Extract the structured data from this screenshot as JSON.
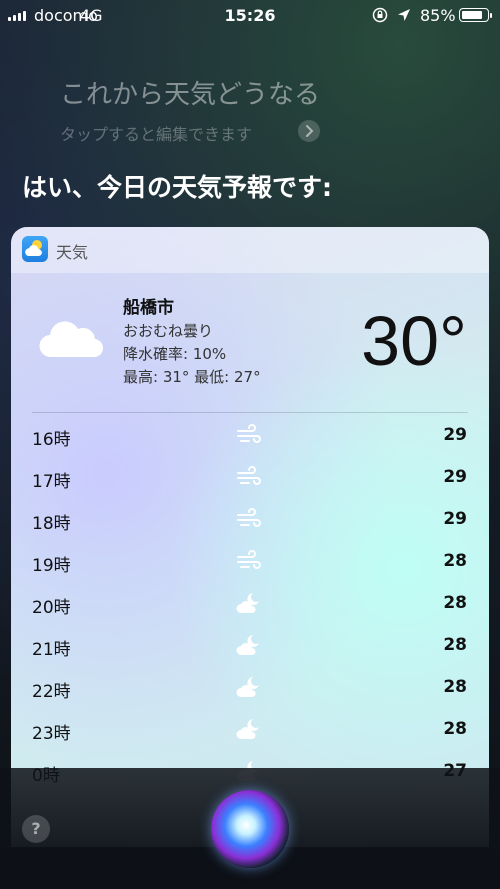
{
  "status": {
    "carrier": "docomo",
    "network": "4G",
    "time": "15:26",
    "battery": "85%",
    "battery_level": 0.85
  },
  "siri": {
    "query": "これから天気どうなる",
    "edit_hint": "タップすると編集できます",
    "response": "はい、今日の天気予報です:"
  },
  "weather": {
    "app_name": "天気",
    "city": "船橋市",
    "condition": "おおむね曇り",
    "precip": "降水確率: 10%",
    "hilo": "最高: 31° 最低: 27°",
    "temp": "30°",
    "hours": [
      {
        "time": "16時",
        "icon": "wind-icon",
        "temp": "29"
      },
      {
        "time": "17時",
        "icon": "wind-icon",
        "temp": "29"
      },
      {
        "time": "18時",
        "icon": "wind-icon",
        "temp": "29"
      },
      {
        "time": "19時",
        "icon": "wind-icon",
        "temp": "28"
      },
      {
        "time": "20時",
        "icon": "partly-cloudy-night-icon",
        "temp": "28"
      },
      {
        "time": "21時",
        "icon": "partly-cloudy-night-icon",
        "temp": "28"
      },
      {
        "time": "22時",
        "icon": "partly-cloudy-night-icon",
        "temp": "28"
      },
      {
        "time": "23時",
        "icon": "partly-cloudy-night-icon",
        "temp": "28"
      },
      {
        "time": "0時",
        "icon": "partly-cloudy-night-icon",
        "temp": "27"
      }
    ]
  },
  "bottom": {
    "help_label": "?"
  }
}
